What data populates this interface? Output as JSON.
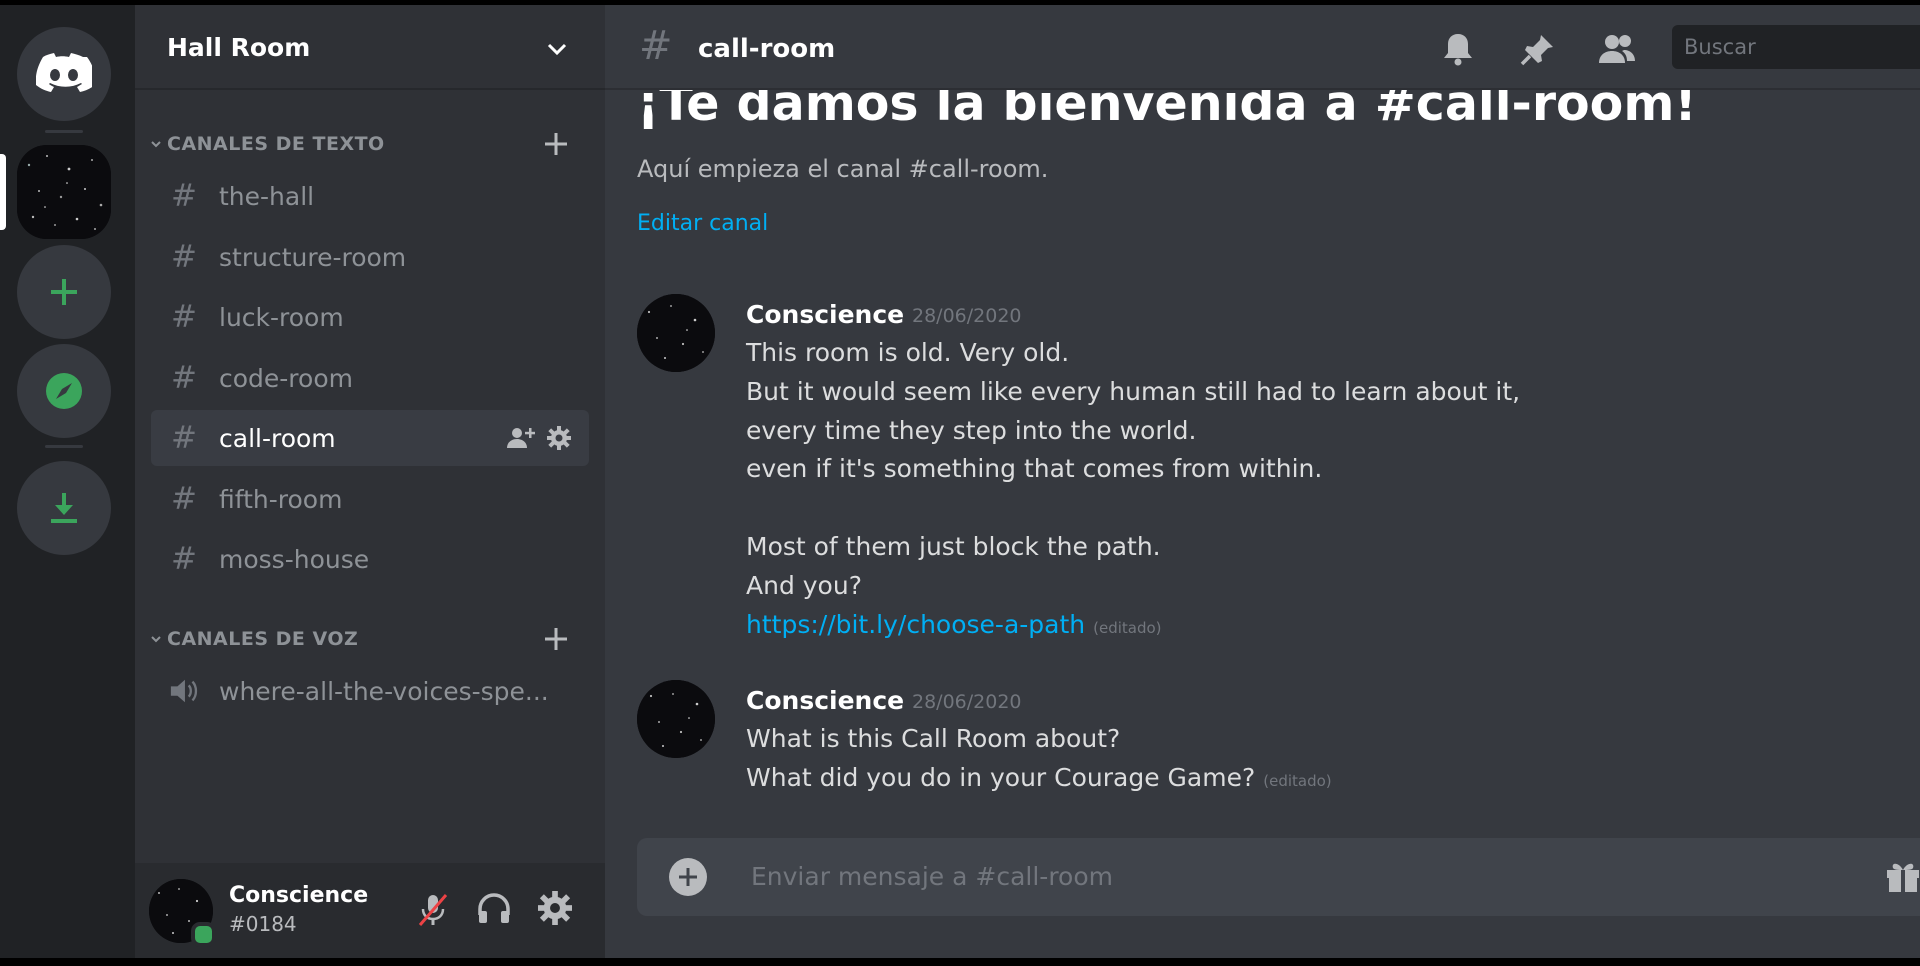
{
  "server": {
    "name": "Hall Room"
  },
  "rail": {
    "items": [
      {
        "name": "discord-home",
        "icon": "discord-logo-icon"
      },
      {
        "name": "hall-room-server",
        "icon": "starfield-server-icon"
      },
      {
        "name": "add-server",
        "icon": "plus-icon"
      },
      {
        "name": "explore-servers",
        "icon": "compass-icon"
      },
      {
        "name": "download-apps",
        "icon": "download-icon"
      }
    ]
  },
  "categories": {
    "text": {
      "label": "CANALES DE TEXTO",
      "channels": [
        {
          "name": "the-hall"
        },
        {
          "name": "structure-room"
        },
        {
          "name": "luck-room"
        },
        {
          "name": "code-room"
        },
        {
          "name": "call-room",
          "active": true
        },
        {
          "name": "fifth-room"
        },
        {
          "name": "moss-house"
        }
      ]
    },
    "voice": {
      "label": "CANALES DE VOZ",
      "channels": [
        {
          "name": "where-all-the-voices-spe..."
        }
      ]
    }
  },
  "user": {
    "name": "Conscience",
    "tag": "#0184",
    "status": "online",
    "status_color": "#3ba55c"
  },
  "channel": {
    "hash": "#",
    "name": "call-room",
    "welcome_title": "¡Te damos la bienvenida a #call-room!",
    "welcome_sub": "Aquí empieza el canal #call-room.",
    "edit_label": "Editar canal"
  },
  "search": {
    "placeholder": "Buscar"
  },
  "messages": [
    {
      "author": "Conscience",
      "time": "28/06/2020",
      "lines": [
        "This room is old. Very old.",
        "But it would seem like every human still had to learn about it,",
        "every time they step into the world.",
        "even if it's something that comes from within.",
        "",
        "Most of them just block the path.",
        "And you?"
      ],
      "link": "https://bit.ly/choose-a-path",
      "edited": "(editado)"
    },
    {
      "author": "Conscience",
      "time": "28/06/2020",
      "lines": [
        "What is this Call Room about?",
        "What did you do in your Courage Game?"
      ],
      "edited": "(editado)"
    }
  ],
  "composer": {
    "placeholder": "Enviar mensaje a #call-room"
  },
  "colors": {
    "rail_bg": "#202225",
    "sidebar_bg": "#2f3136",
    "main_bg": "#36393f",
    "link": "#00aff4",
    "green": "#3ba55c"
  }
}
